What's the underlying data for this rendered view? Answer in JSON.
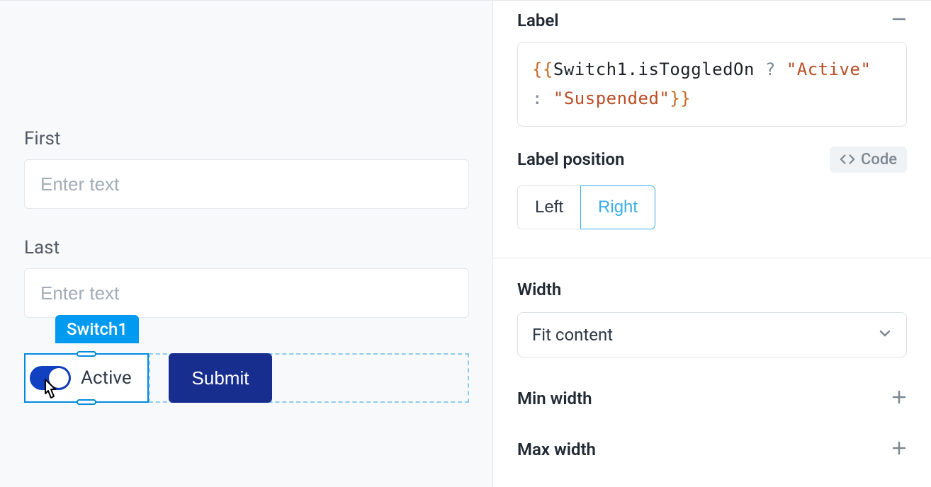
{
  "canvas": {
    "first_label": "First",
    "first_placeholder": "Enter text",
    "last_label": "Last",
    "last_placeholder": "Enter text",
    "switch_name": "Switch1",
    "switch_state_label": "Active",
    "submit_label": "Submit"
  },
  "props": {
    "label_section_title": "Label",
    "label_code": {
      "open": "{{",
      "expr_ident": "Switch1.isToggledOn",
      "expr_q": " ? ",
      "str_true": "\"Active\"",
      "expr_colon": " : ",
      "str_false": "\"Suspended\"",
      "close": "}}"
    },
    "label_position_title": "Label position",
    "code_chip": "Code",
    "seg_left": "Left",
    "seg_right": "Right",
    "width_title": "Width",
    "width_value": "Fit content",
    "min_width_title": "Min width",
    "max_width_title": "Max width"
  }
}
